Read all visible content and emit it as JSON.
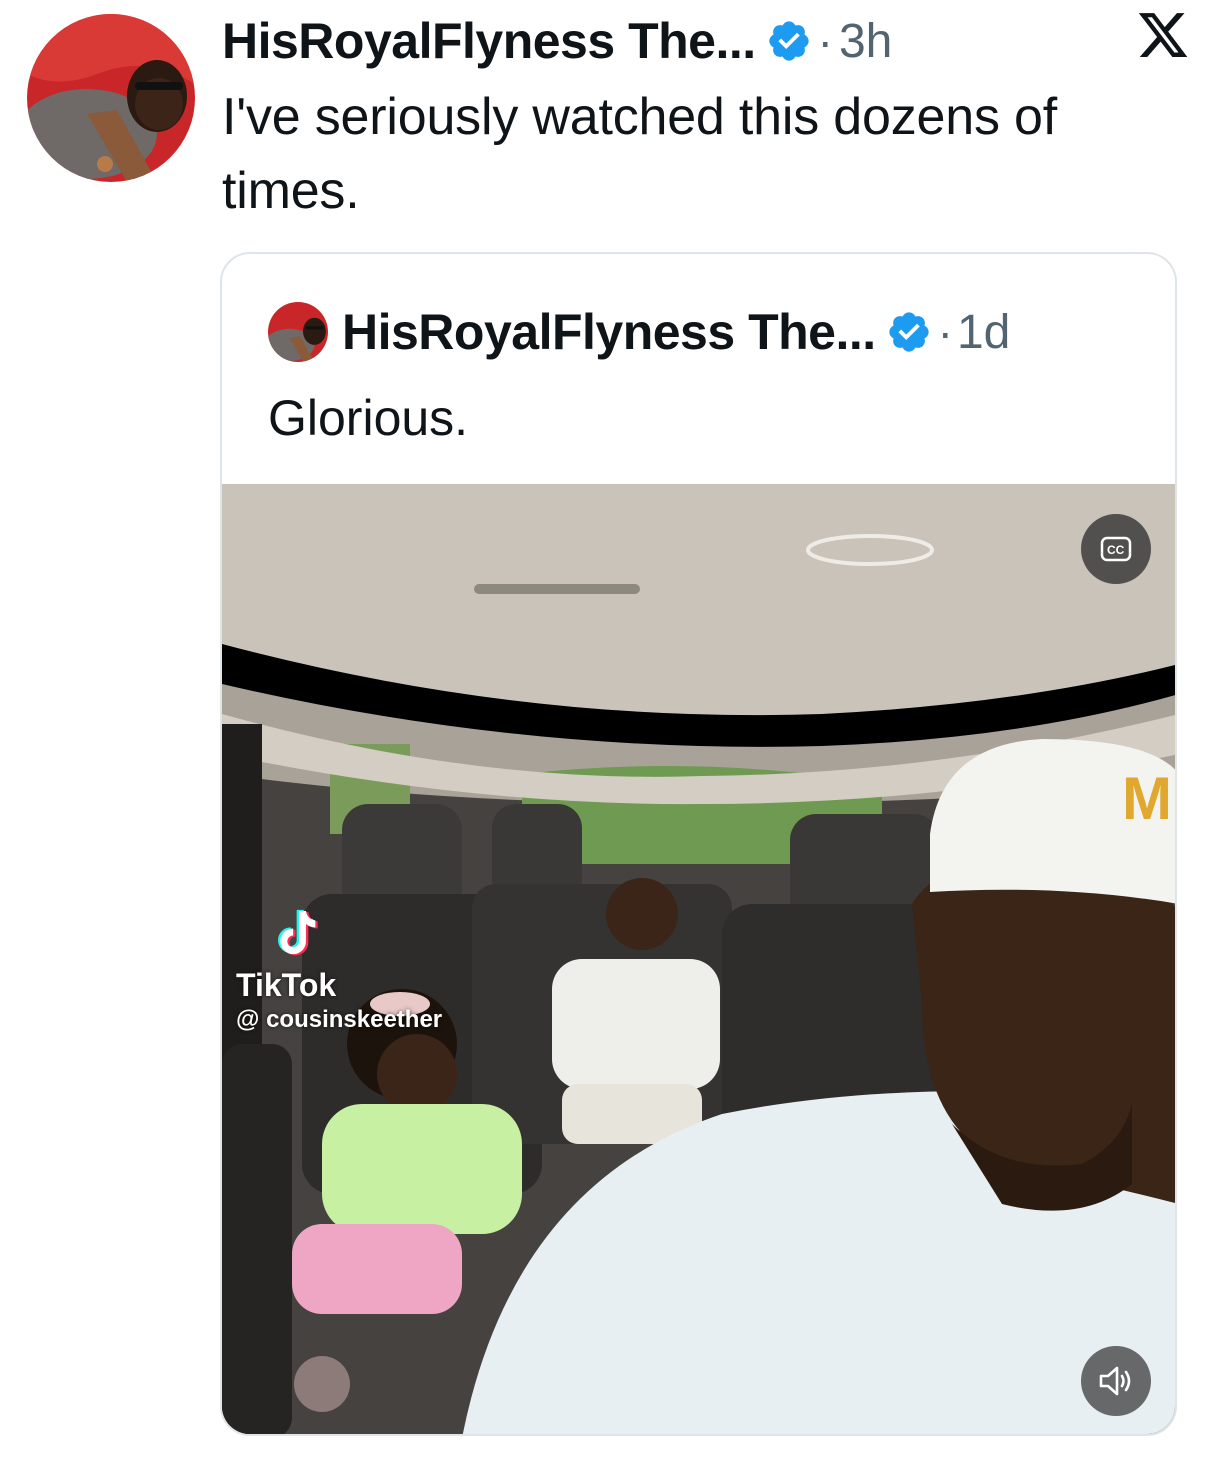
{
  "post": {
    "author_name": "HisRoyalFlyness The...",
    "separator": "·",
    "time": "3h",
    "text": "I've seriously watched this dozens of times.",
    "avatar_icon": "profile-photo",
    "verified_color": "#1d9bf0"
  },
  "quoted": {
    "author_name": "HisRoyalFlyness The...",
    "separator": "·",
    "time": "1d",
    "text": "Glorious.",
    "media": {
      "watermark_brand": "TikTok",
      "watermark_handle": "@ cousinskeether",
      "captions_icon": "cc-icon",
      "volume_icon": "volume-icon",
      "cap_letter": "M"
    }
  },
  "brand_icon": "x-logo"
}
